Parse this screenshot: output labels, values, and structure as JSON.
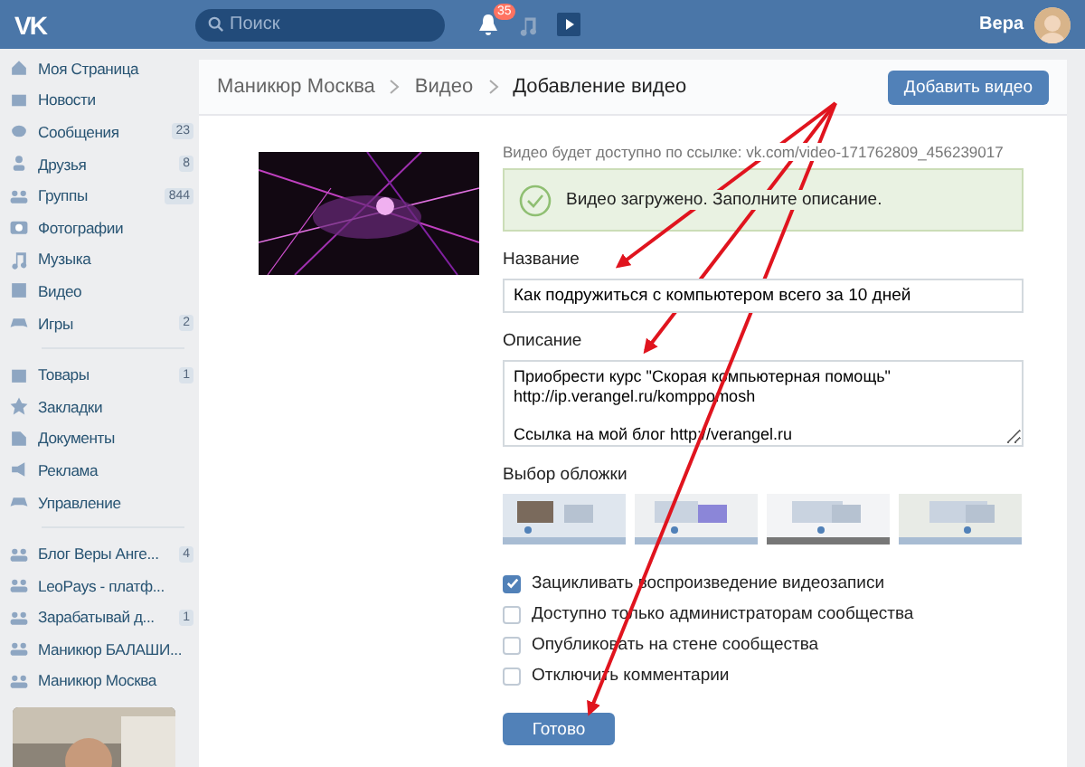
{
  "header": {
    "logo": "VK",
    "search": {
      "placeholder": "Поиск"
    },
    "notification_count": "35",
    "user_name": "Вера"
  },
  "sidebar": {
    "sections": [
      {
        "items": [
          {
            "label": "Моя Страница"
          },
          {
            "label": "Новости"
          },
          {
            "label": "Сообщения",
            "count": "23"
          },
          {
            "label": "Друзья",
            "count": "8"
          },
          {
            "label": "Группы",
            "count": "844"
          },
          {
            "label": "Фотографии"
          },
          {
            "label": "Музыка"
          },
          {
            "label": "Видео"
          },
          {
            "label": "Игры",
            "count": "2"
          }
        ]
      },
      {
        "items": [
          {
            "label": "Товары",
            "count": "1"
          },
          {
            "label": "Закладки"
          },
          {
            "label": "Документы"
          },
          {
            "label": "Реклама"
          },
          {
            "label": "Управление"
          }
        ]
      },
      {
        "items": [
          {
            "label": "Блог Веры Анге...",
            "count": "4"
          },
          {
            "label": "LeoPays - платф..."
          },
          {
            "label": "Зарабатывай д...",
            "count": "1"
          },
          {
            "label": "Маникюр БАЛАШИ..."
          },
          {
            "label": "Маникюр Москва"
          }
        ]
      }
    ]
  },
  "breadcrumb": [
    "Маникюр Москва",
    "Видео",
    "Добавление видео"
  ],
  "add_video_button": "Добавить видео",
  "form": {
    "link_text": "Видео будет доступно по ссылке: vk.com/video-171762809_456239017",
    "success_message": "Видео загружено. Заполните описание.",
    "title_label": "Название",
    "title_value": "Как подружиться с компьютером всего за 10 дней",
    "description_label": "Описание",
    "description_value": "Приобрести курс \"Скорая компьютерная помощь\"\nhttp://ip.verangel.ru/komppomosh\n\nСсылка на мой блог http://verangel.ru",
    "cover_label": "Выбор обложки",
    "checkboxes": [
      {
        "label": "Зацикливать воспроизведение видеозаписи",
        "checked": true
      },
      {
        "label": "Доступно только администраторам сообщества",
        "checked": false
      },
      {
        "label": "Опубликовать на стене сообщества",
        "checked": false
      },
      {
        "label": "Отключить комментарии",
        "checked": false
      }
    ],
    "submit_button": "Готово"
  }
}
